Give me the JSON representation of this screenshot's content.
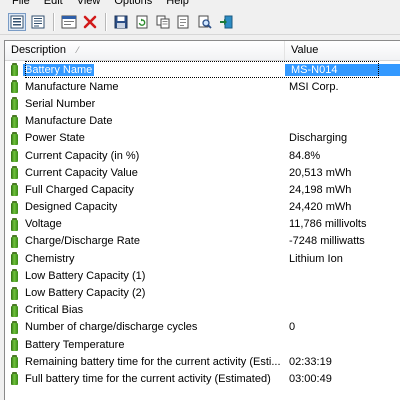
{
  "menu": [
    "File",
    "Edit",
    "View",
    "Options",
    "Help"
  ],
  "toolbar": {
    "buttons": [
      {
        "name": "list-view-icon",
        "pressed": true
      },
      {
        "name": "details-view-icon",
        "pressed": false
      },
      {
        "name": "properties-icon",
        "pressed": false
      },
      {
        "name": "delete-icon",
        "pressed": false
      },
      {
        "name": "save-icon",
        "pressed": false
      },
      {
        "name": "refresh-icon",
        "pressed": false
      },
      {
        "name": "copy-icon",
        "pressed": false
      },
      {
        "name": "find-icon",
        "pressed": false
      },
      {
        "name": "search-icon",
        "pressed": false
      },
      {
        "name": "exit-icon",
        "pressed": false
      }
    ]
  },
  "columns": {
    "description": "Description",
    "value": "Value"
  },
  "rows": [
    {
      "description": "Battery Name",
      "value": "MS-N014",
      "selected": true
    },
    {
      "description": "Manufacture Name",
      "value": "MSI Corp."
    },
    {
      "description": "Serial Number",
      "value": ""
    },
    {
      "description": "Manufacture Date",
      "value": ""
    },
    {
      "description": "Power State",
      "value": "Discharging"
    },
    {
      "description": "Current Capacity (in %)",
      "value": "84.8%"
    },
    {
      "description": "Current Capacity Value",
      "value": "20,513 mWh"
    },
    {
      "description": "Full Charged Capacity",
      "value": "24,198 mWh"
    },
    {
      "description": "Designed Capacity",
      "value": "24,420 mWh"
    },
    {
      "description": "Voltage",
      "value": "11,786 millivolts"
    },
    {
      "description": "Charge/Discharge Rate",
      "value": "-7248 milliwatts"
    },
    {
      "description": "Chemistry",
      "value": "Lithium Ion"
    },
    {
      "description": "Low Battery Capacity (1)",
      "value": ""
    },
    {
      "description": "Low Battery Capacity (2)",
      "value": ""
    },
    {
      "description": "Critical Bias",
      "value": ""
    },
    {
      "description": "Number of charge/discharge cycles",
      "value": "0"
    },
    {
      "description": "Battery Temperature",
      "value": ""
    },
    {
      "description": "Remaining battery time for the current activity (Esti...",
      "value": "02:33:19"
    },
    {
      "description": "Full battery time for the current activity (Estimated)",
      "value": "03:00:49"
    }
  ],
  "colors": {
    "selection": "#3399ff",
    "battery_icon": "#4fa12a"
  }
}
